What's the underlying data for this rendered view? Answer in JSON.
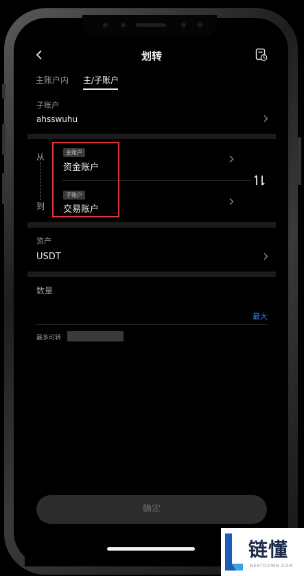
{
  "nav": {
    "title": "划转",
    "back_icon": "chevron-left-icon",
    "records_icon": "transfer-records-icon"
  },
  "tabs": [
    {
      "label": "主账户内",
      "active": false
    },
    {
      "label": "主/子账户",
      "active": true
    }
  ],
  "sub_account": {
    "label": "子账户",
    "value": "ahsswuhu"
  },
  "transfer": {
    "from_label": "从",
    "to_label": "到",
    "from_account": {
      "tag": "主账户",
      "name": "资金账户"
    },
    "to_account": {
      "tag": "子账户",
      "name": "交易账户"
    },
    "swap_icon": "swap-vertical-icon"
  },
  "asset": {
    "label": "资产",
    "value": "USDT"
  },
  "quantity": {
    "label": "数量",
    "max_label": "最大"
  },
  "available": {
    "label": "最多可转"
  },
  "confirm_label": "确定",
  "watermark": {
    "text": "链懂",
    "sub": "NEATDOWN.COM"
  },
  "colors": {
    "highlight": "#e2363c",
    "accent": "#3a7ee8",
    "background": "#000000"
  }
}
